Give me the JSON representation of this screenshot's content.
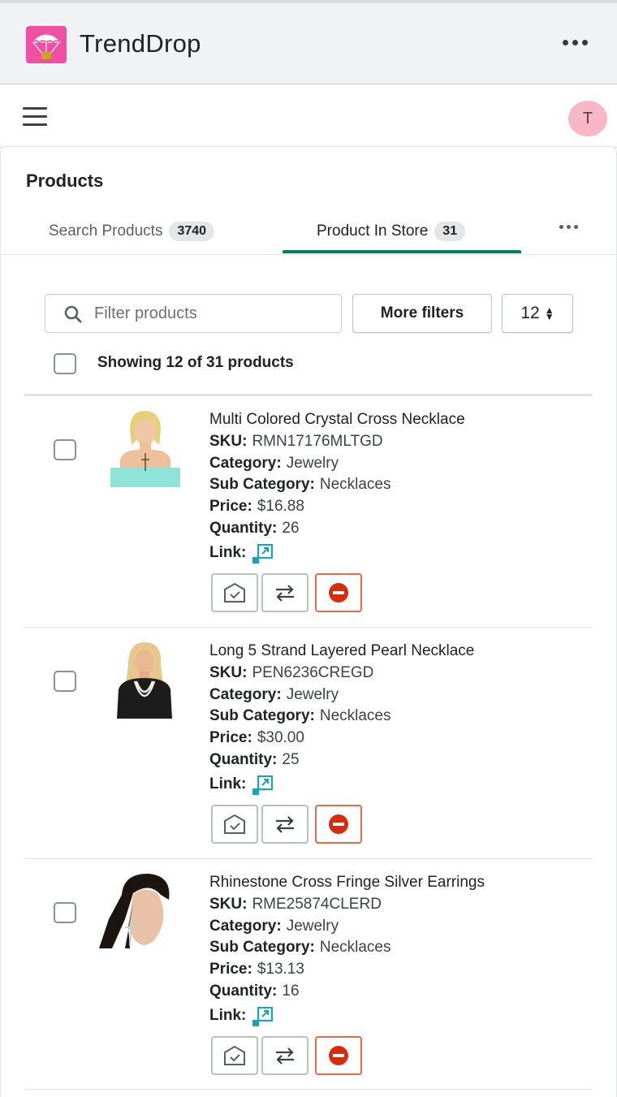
{
  "app": {
    "title": "TrendDrop"
  },
  "user": {
    "avatar_initial": "T"
  },
  "page": {
    "title": "Products"
  },
  "tabs": [
    {
      "label": "Search Products",
      "count": "3740"
    },
    {
      "label": "Product In Store",
      "count": "31",
      "active": true
    }
  ],
  "filters": {
    "search_placeholder": "Filter products",
    "more_filters_label": "More filters",
    "per_page": "12"
  },
  "summary": {
    "showing_text": "Showing 12 of 31 products"
  },
  "field_labels": {
    "sku": "SKU:",
    "category": "Category:",
    "sub_category": "Sub Category:",
    "price": "Price:",
    "quantity": "Quantity:",
    "link": "Link:"
  },
  "colors": {
    "accent": "#008060",
    "brand": "#f24fa3",
    "link_icon": "#1aa3b8",
    "danger": "#d72c0d"
  },
  "products": [
    {
      "name": "Multi Colored Crystal Cross Necklace",
      "sku": "RMN17176MLTGD",
      "category": "Jewelry",
      "sub_category": "Necklaces",
      "price": "$16.88",
      "quantity": "26"
    },
    {
      "name": "Long 5 Strand Layered Pearl Necklace",
      "sku": "PEN6236CREGD",
      "category": "Jewelry",
      "sub_category": "Necklaces",
      "price": "$30.00",
      "quantity": "25"
    },
    {
      "name": "Rhinestone Cross Fringe Silver Earrings",
      "sku": "RME25874CLERD",
      "category": "Jewelry",
      "sub_category": "Necklaces",
      "price": "$13.13",
      "quantity": "16"
    }
  ]
}
